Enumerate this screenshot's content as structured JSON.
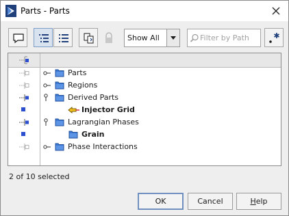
{
  "window": {
    "title": "Parts - Parts"
  },
  "toolbar": {
    "filter_placeholder": "Filter by Path",
    "show_selected": "Show All",
    "regex_symbol": ".*"
  },
  "tree": {
    "rows": [
      {
        "label": "Parts",
        "bold": false
      },
      {
        "label": "Regions",
        "bold": false
      },
      {
        "label": "Derived Parts",
        "bold": false
      },
      {
        "label": "Injector Grid",
        "bold": true
      },
      {
        "label": "Lagrangian Phases",
        "bold": false
      },
      {
        "label": "Grain",
        "bold": true
      },
      {
        "label": "Phase Interactions",
        "bold": false
      }
    ]
  },
  "status": {
    "selection": "2 of 10 selected"
  },
  "buttons": {
    "ok": "OK",
    "cancel": "Cancel",
    "help_mnemonic": "H",
    "help_rest": "elp"
  },
  "colors": {
    "accent": "#2f5aa6",
    "folder": "#3d7ad6",
    "selected_marker": "#2b4fcf"
  }
}
